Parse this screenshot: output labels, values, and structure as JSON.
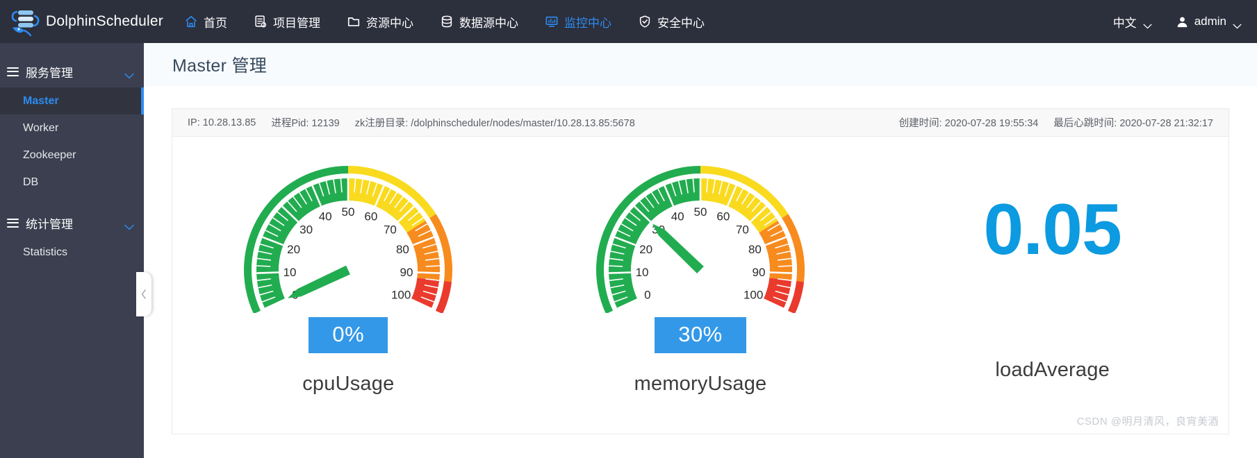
{
  "header": {
    "brand": "DolphinScheduler",
    "nav": [
      {
        "label": "首页",
        "icon": "home-icon",
        "active": false
      },
      {
        "label": "项目管理",
        "icon": "project-icon",
        "active": false
      },
      {
        "label": "资源中心",
        "icon": "folder-icon",
        "active": false
      },
      {
        "label": "数据源中心",
        "icon": "database-icon",
        "active": false
      },
      {
        "label": "监控中心",
        "icon": "monitor-icon",
        "active": true
      },
      {
        "label": "安全中心",
        "icon": "shield-check-icon",
        "active": false
      }
    ],
    "language": "中文",
    "user": "admin"
  },
  "sidebar": {
    "groups": [
      {
        "label": "服务管理",
        "items": [
          {
            "label": "Master",
            "active": true
          },
          {
            "label": "Worker",
            "active": false
          },
          {
            "label": "Zookeeper",
            "active": false
          },
          {
            "label": "DB",
            "active": false
          }
        ]
      },
      {
        "label": "统计管理",
        "items": [
          {
            "label": "Statistics",
            "active": false
          }
        ]
      }
    ]
  },
  "page": {
    "title": "Master 管理"
  },
  "info_bar": {
    "ip_label": "IP:",
    "ip_value": "10.28.13.85",
    "pid_label": "进程Pid:",
    "pid_value": "12139",
    "zk_label": "zk注册目录:",
    "zk_value": "/dolphinscheduler/nodes/master/10.28.13.85:5678",
    "created_label": "创建时间:",
    "created_value": "2020-07-28 19:55:34",
    "heartbeat_label": "最后心跳时间:",
    "heartbeat_value": "2020-07-28 21:32:17"
  },
  "colors": {
    "accent": "#2d8cf0",
    "badge": "#3398e8",
    "load_value": "#0c9ae0",
    "gauge_green": "#22ac50",
    "gauge_yellow": "#fada1e",
    "gauge_orange": "#f78b1e",
    "gauge_red": "#ea3a2d"
  },
  "chart_data": [
    {
      "type": "gauge",
      "title": "cpuUsage",
      "value": 0,
      "display_value": "0%",
      "min": 0,
      "max": 100,
      "tick_labels": [
        "0",
        "10",
        "20",
        "30",
        "40",
        "50",
        "60",
        "70",
        "80",
        "90",
        "100"
      ],
      "bands": [
        {
          "from": 0,
          "to": 50,
          "color": "#22ac50"
        },
        {
          "from": 50,
          "to": 75,
          "color": "#fada1e"
        },
        {
          "from": 75,
          "to": 92,
          "color": "#f78b1e"
        },
        {
          "from": 92,
          "to": 100,
          "color": "#ea3a2d"
        }
      ],
      "needle_color": "#22ac50"
    },
    {
      "type": "gauge",
      "title": "memoryUsage",
      "value": 30,
      "display_value": "30%",
      "min": 0,
      "max": 100,
      "tick_labels": [
        "0",
        "10",
        "20",
        "30",
        "40",
        "50",
        "60",
        "70",
        "80",
        "90",
        "100"
      ],
      "bands": [
        {
          "from": 0,
          "to": 50,
          "color": "#22ac50"
        },
        {
          "from": 50,
          "to": 75,
          "color": "#fada1e"
        },
        {
          "from": 75,
          "to": 92,
          "color": "#f78b1e"
        },
        {
          "from": 92,
          "to": 100,
          "color": "#ea3a2d"
        }
      ],
      "needle_color": "#22ac50"
    },
    {
      "type": "number",
      "title": "loadAverage",
      "display_value": "0.05"
    }
  ],
  "watermark": "CSDN @明月清风，良宵美酒"
}
